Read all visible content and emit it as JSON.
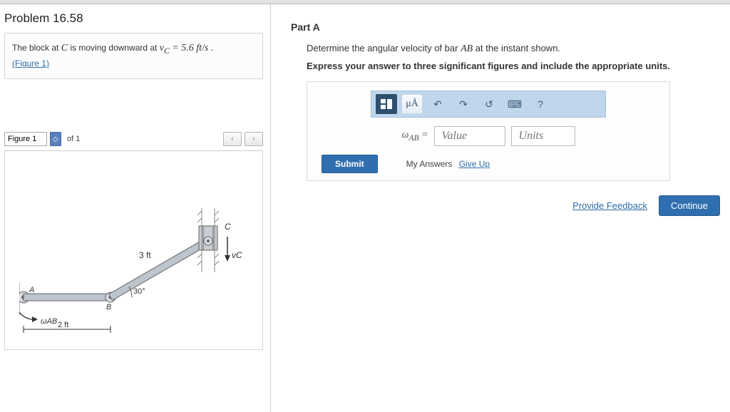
{
  "problem": {
    "title": "Problem 16.58",
    "prefix": "The block at ",
    "block_var": "C",
    "mid": " is moving downward at ",
    "vc_var": "v",
    "vc_sub": "C",
    "eq": " = 5.6 ft/s .",
    "figure_link": "(Figure 1)"
  },
  "figureNav": {
    "label": "Figure 1",
    "of": "of 1",
    "prev": "‹",
    "next": "›"
  },
  "diagram": {
    "bar_bc_len": "3 ft",
    "ab_len": "2 ft",
    "angle": "30°",
    "omega_label": "ωAB",
    "point_a": "A",
    "point_b": "B",
    "point_c": "C",
    "vc": "vC"
  },
  "partA": {
    "title": "Part A",
    "question_prefix": "Determine the angular velocity of bar ",
    "bar": "AB",
    "question_suffix": " at the instant shown.",
    "instruction": "Express your answer to three significant figures and include the appropriate units."
  },
  "answer": {
    "omega": "ω",
    "sub": "AB",
    "equals": " =",
    "value_ph": "Value",
    "units_ph": "Units",
    "submit": "Submit",
    "myanswers": "My Answers",
    "giveup": "Give Up"
  },
  "toolbar": {
    "t1": "⎕",
    "t2": "μÅ",
    "undo": "↶",
    "redo": "↷",
    "reset": "↺",
    "kbd": "⌨",
    "help": "?"
  },
  "footer": {
    "feedback": "Provide Feedback",
    "continue": "Continue"
  }
}
